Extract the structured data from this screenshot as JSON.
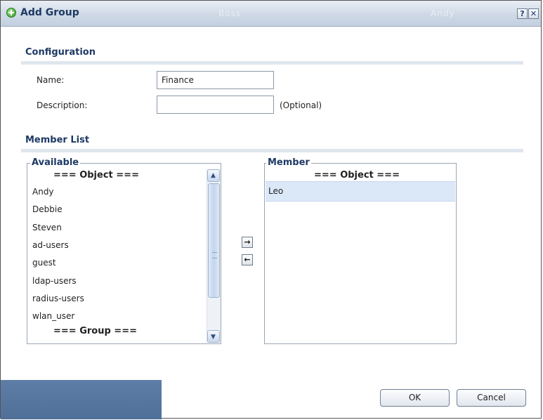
{
  "dialog": {
    "title": "Add Group",
    "ghost_texts": [
      "Boss",
      "Andy"
    ],
    "help_glyph": "?",
    "close_glyph": "✕"
  },
  "configuration": {
    "heading": "Configuration",
    "name_label": "Name:",
    "name_value": "Finance",
    "description_label": "Description:",
    "description_value": "",
    "optional_note": "(Optional)"
  },
  "member_list": {
    "heading": "Member List",
    "available": {
      "legend": "Available",
      "object_header": "=== Object ===",
      "items": [
        "Andy",
        "Debbie",
        "Steven",
        "ad-users",
        "guest",
        "ldap-users",
        "radius-users",
        "wlan_user"
      ],
      "group_header": "=== Group ==="
    },
    "member": {
      "legend": "Member",
      "object_header": "=== Object ===",
      "items": [
        "Leo"
      ]
    },
    "add_glyph": "→",
    "remove_glyph": "←"
  },
  "buttons": {
    "ok": "OK",
    "cancel": "Cancel"
  },
  "colors": {
    "title_text": "#1e3a64",
    "section_rule": "#dfe6ee",
    "selected_row": "#dbe8f8"
  }
}
